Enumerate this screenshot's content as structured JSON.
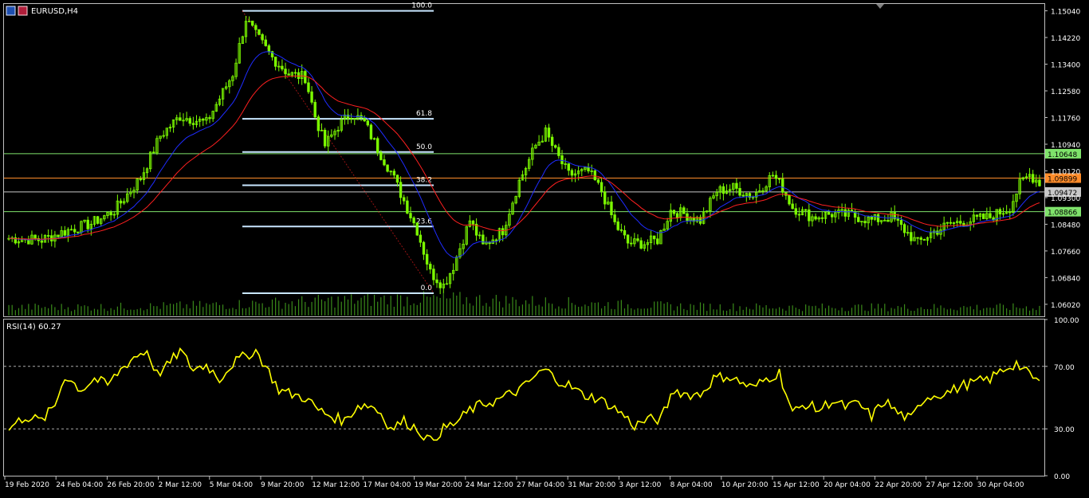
{
  "window": {
    "symbol_label": "EURUSD,H4",
    "icon": "chart-window-icon"
  },
  "colors": {
    "background": "#000000",
    "candle": "#7cfc00",
    "ma_fast": "#1f2cff",
    "ma_slow": "#ff2020",
    "rsi": "#ffff00",
    "fib": "#c8e6ff",
    "frame": "#c0c0c0",
    "text": "#ffffff",
    "line_resistance": "#7fe36b",
    "line_mid": "#ff8c2a",
    "line_current": "#c8c8c8",
    "line_support": "#7fe36b"
  },
  "chart_data": [
    {
      "type": "candlestick",
      "symbol": "EURUSD",
      "timeframe": "H4",
      "ylim": [
        1.0565,
        1.1525
      ],
      "y_ticks": [
        "1.15040",
        "1.14220",
        "1.13400",
        "1.12580",
        "1.11760",
        "1.10940",
        "1.10120",
        "1.09300",
        "1.08480",
        "1.07660",
        "1.06840",
        "1.06020"
      ],
      "x_labels": [
        "19 Feb 2020",
        "24 Feb 04:00",
        "26 Feb 20:00",
        "2 Mar 12:00",
        "5 Mar 04:00",
        "9 Mar 20:00",
        "12 Mar 12:00",
        "17 Mar 04:00",
        "19 Mar 20:00",
        "24 Mar 12:00",
        "27 Mar 04:00",
        "31 Mar 20:00",
        "3 Apr 12:00",
        "8 Apr 04:00",
        "10 Apr 20:00",
        "15 Apr 12:00",
        "20 Apr 04:00",
        "22 Apr 20:00",
        "27 Apr 12:00",
        "30 Apr 04:00"
      ],
      "close_anchors": [
        [
          0,
          1.0805
        ],
        [
          10,
          1.08
        ],
        [
          18,
          1.083
        ],
        [
          25,
          1.085
        ],
        [
          32,
          1.089
        ],
        [
          40,
          1.099
        ],
        [
          46,
          1.112
        ],
        [
          52,
          1.118
        ],
        [
          60,
          1.116
        ],
        [
          68,
          1.131
        ],
        [
          72,
          1.148
        ],
        [
          75,
          1.143
        ],
        [
          80,
          1.136
        ],
        [
          85,
          1.131
        ],
        [
          90,
          1.13
        ],
        [
          93,
          1.118
        ],
        [
          96,
          1.109
        ],
        [
          100,
          1.115
        ],
        [
          104,
          1.119
        ],
        [
          108,
          1.116
        ],
        [
          112,
          1.108
        ],
        [
          116,
          1.101
        ],
        [
          120,
          1.092
        ],
        [
          124,
          1.083
        ],
        [
          128,
          1.07
        ],
        [
          132,
          1.066
        ],
        [
          135,
          1.072
        ],
        [
          140,
          1.086
        ],
        [
          144,
          1.078
        ],
        [
          150,
          1.083
        ],
        [
          155,
          1.098
        ],
        [
          160,
          1.109
        ],
        [
          163,
          1.113
        ],
        [
          166,
          1.107
        ],
        [
          170,
          1.1
        ],
        [
          176,
          1.101
        ],
        [
          180,
          1.095
        ],
        [
          184,
          1.085
        ],
        [
          188,
          1.079
        ],
        [
          193,
          1.079
        ],
        [
          197,
          1.08
        ],
        [
          201,
          1.089
        ],
        [
          205,
          1.088
        ],
        [
          210,
          1.086
        ],
        [
          215,
          1.095
        ],
        [
          220,
          1.096
        ],
        [
          226,
          1.0935
        ],
        [
          232,
          1.1
        ],
        [
          235,
          1.096
        ],
        [
          238,
          1.09
        ],
        [
          244,
          1.087
        ],
        [
          250,
          1.088
        ],
        [
          256,
          1.0875
        ],
        [
          262,
          1.086
        ],
        [
          268,
          1.087
        ],
        [
          272,
          1.083
        ],
        [
          276,
          1.079
        ],
        [
          280,
          1.082
        ],
        [
          286,
          1.085
        ],
        [
          292,
          1.086
        ],
        [
          298,
          1.087
        ],
        [
          304,
          1.09
        ],
        [
          307,
          1.097
        ],
        [
          310,
          1.1
        ],
        [
          313,
          1.0978
        ]
      ],
      "ma_fast_label": "blue moving average",
      "ma_slow_label": "red moving average",
      "fibonacci": {
        "high": 1.1504,
        "low": 1.0636,
        "levels": [
          {
            "label": "100.0",
            "value": 1.1504
          },
          {
            "label": "61.8",
            "value": 1.1172
          },
          {
            "label": "50.0",
            "value": 1.107
          },
          {
            "label": "38.2",
            "value": 1.0968
          },
          {
            "label": "23.6",
            "value": 1.0841
          },
          {
            "label": "0.0",
            "value": 1.0636
          }
        ]
      },
      "horizontal_lines": [
        {
          "name": "resistance",
          "value": 1.10648,
          "label": "1.10648",
          "color": "#7fe36b"
        },
        {
          "name": "mid",
          "value": 1.09899,
          "label": "1.09899",
          "color": "#ff8c2a"
        },
        {
          "name": "current",
          "value": 1.09472,
          "label": "1.09472",
          "color": "#c8c8c8"
        },
        {
          "name": "support",
          "value": 1.08866,
          "label": "1.08866",
          "color": "#7fe36b"
        }
      ]
    },
    {
      "type": "line",
      "name": "RSI(14)",
      "label": "RSI(14) 60.27",
      "ylim": [
        0,
        100
      ],
      "y_ticks": [
        "100.00",
        "70.00",
        "30.00",
        "0.00"
      ],
      "levels": [
        70,
        30
      ],
      "anchors": [
        [
          0,
          30
        ],
        [
          5,
          38
        ],
        [
          10,
          35
        ],
        [
          14,
          45
        ],
        [
          17,
          64
        ],
        [
          22,
          55
        ],
        [
          26,
          62
        ],
        [
          30,
          58
        ],
        [
          34,
          68
        ],
        [
          38,
          76
        ],
        [
          42,
          80
        ],
        [
          45,
          65
        ],
        [
          48,
          70
        ],
        [
          52,
          80
        ],
        [
          56,
          68
        ],
        [
          60,
          71
        ],
        [
          64,
          62
        ],
        [
          68,
          72
        ],
        [
          72,
          77
        ],
        [
          75,
          80
        ],
        [
          78,
          70
        ],
        [
          82,
          55
        ],
        [
          86,
          52
        ],
        [
          90,
          50
        ],
        [
          94,
          42
        ],
        [
          98,
          38
        ],
        [
          102,
          35
        ],
        [
          106,
          45
        ],
        [
          110,
          45
        ],
        [
          113,
          40
        ],
        [
          116,
          30
        ],
        [
          120,
          35
        ],
        [
          124,
          30
        ],
        [
          128,
          22
        ],
        [
          132,
          30
        ],
        [
          136,
          34
        ],
        [
          140,
          42
        ],
        [
          144,
          46
        ],
        [
          148,
          48
        ],
        [
          152,
          52
        ],
        [
          156,
          56
        ],
        [
          160,
          64
        ],
        [
          163,
          68
        ],
        [
          166,
          62
        ],
        [
          170,
          58
        ],
        [
          174,
          52
        ],
        [
          178,
          50
        ],
        [
          182,
          46
        ],
        [
          186,
          40
        ],
        [
          190,
          32
        ],
        [
          194,
          36
        ],
        [
          198,
          36
        ],
        [
          202,
          55
        ],
        [
          206,
          52
        ],
        [
          210,
          52
        ],
        [
          214,
          62
        ],
        [
          218,
          64
        ],
        [
          222,
          60
        ],
        [
          226,
          56
        ],
        [
          230,
          62
        ],
        [
          234,
          66
        ],
        [
          238,
          40
        ],
        [
          242,
          46
        ],
        [
          246,
          42
        ],
        [
          250,
          48
        ],
        [
          254,
          44
        ],
        [
          258,
          46
        ],
        [
          262,
          38
        ],
        [
          266,
          48
        ],
        [
          270,
          40
        ],
        [
          274,
          36
        ],
        [
          278,
          50
        ],
        [
          282,
          52
        ],
        [
          286,
          54
        ],
        [
          290,
          58
        ],
        [
          294,
          60
        ],
        [
          298,
          62
        ],
        [
          302,
          68
        ],
        [
          306,
          72
        ],
        [
          309,
          66
        ],
        [
          313,
          60
        ]
      ]
    }
  ]
}
